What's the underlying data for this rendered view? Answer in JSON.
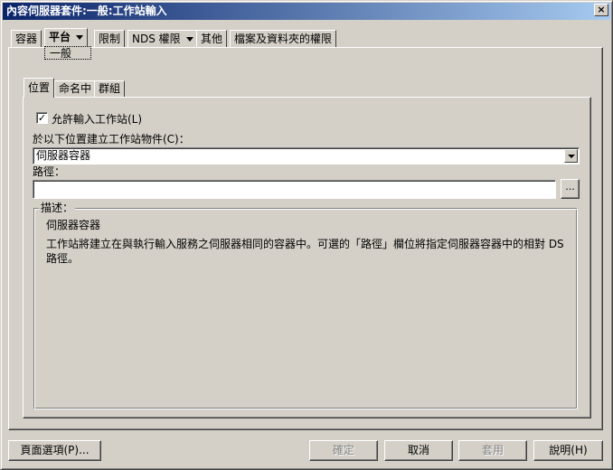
{
  "window": {
    "title": "內容伺服器套件:一般:工作站輸入",
    "close_glyph": "×"
  },
  "tabs": [
    {
      "label": "容器"
    },
    {
      "label": "平台",
      "active": true
    },
    {
      "label": "限制"
    },
    {
      "label": "NDS 權限"
    },
    {
      "label": "其他"
    },
    {
      "label": "檔案及資料夾的權限"
    }
  ],
  "subtab_label": "一般",
  "inner_tabs": [
    {
      "label": "位置",
      "active": true
    },
    {
      "label": "命名中"
    },
    {
      "label": "群組"
    }
  ],
  "form": {
    "allow_checkbox_label": "允許輸入工作站(L)",
    "allow_checked": true,
    "check_glyph": "✓",
    "create_in_label": "於以下位置建立工作站物件(C)：",
    "create_in_value": "伺服器容器",
    "path_label": "路徑：",
    "path_value": "",
    "browse_label": "..."
  },
  "description": {
    "legend": "描述：",
    "title": "伺服器容器",
    "line1": "工作站將建立在與執行輸入服務之伺服器相同的容器中。可選的「路徑」欄位將指定伺服器容器中的相對 DS",
    "line2": "路徑。"
  },
  "buttons": {
    "page_options": "頁面選項(P)...",
    "ok": "確定",
    "cancel": "取消",
    "apply": "套用",
    "help": "說明(H)"
  }
}
